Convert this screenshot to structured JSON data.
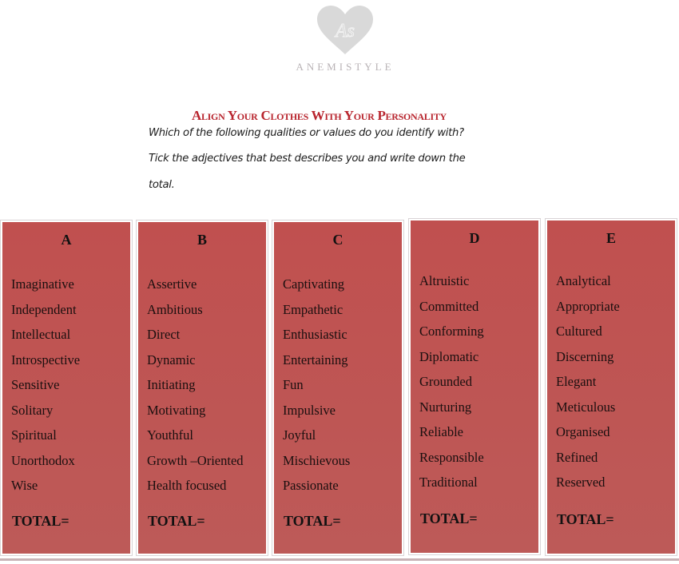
{
  "logo": {
    "monogram": "As",
    "brand": "ANEMISTYLE",
    "heart_color": "#d9d9d9"
  },
  "header": {
    "title": "Align Your Clothes With Your Personality",
    "instructions": [
      "Which of the following qualities or values do you identify with?",
      "Tick the adjectives that best describes you and write down the",
      "total."
    ]
  },
  "theme": {
    "panel_color": "#c0504d",
    "title_color": "#b8252e"
  },
  "columns": [
    {
      "letter": "A",
      "items": [
        "Imaginative",
        "Independent",
        "Intellectual",
        "Introspective",
        "Sensitive",
        "Solitary",
        "Spiritual",
        " Unorthodox",
        "Wise"
      ],
      "total_label": "TOTAL="
    },
    {
      "letter": "B",
      "items": [
        " Assertive",
        "Ambitious",
        "Direct",
        "Dynamic",
        "Initiating",
        " Motivating",
        "Youthful",
        "Growth –Oriented",
        "Health focused"
      ],
      "total_label": "TOTAL="
    },
    {
      "letter": "C",
      "items": [
        "Captivating",
        "Empathetic",
        "Enthusiastic",
        "Entertaining",
        "Fun",
        "Impulsive",
        "Joyful",
        "Mischievous",
        "Passionate"
      ],
      "total_label": "TOTAL="
    },
    {
      "letter": "D",
      "items": [
        "Altruistic",
        "Committed",
        "Conforming",
        "Diplomatic",
        "Grounded",
        "Nurturing",
        "Reliable",
        "Responsible",
        "Traditional"
      ],
      "total_label": "TOTAL="
    },
    {
      "letter": "E",
      "items": [
        "Analytical",
        "Appropriate",
        "Cultured",
        "Discerning",
        "Elegant",
        "Meticulous",
        "Organised",
        "Refined",
        "Reserved"
      ],
      "total_label": "TOTAL="
    }
  ]
}
